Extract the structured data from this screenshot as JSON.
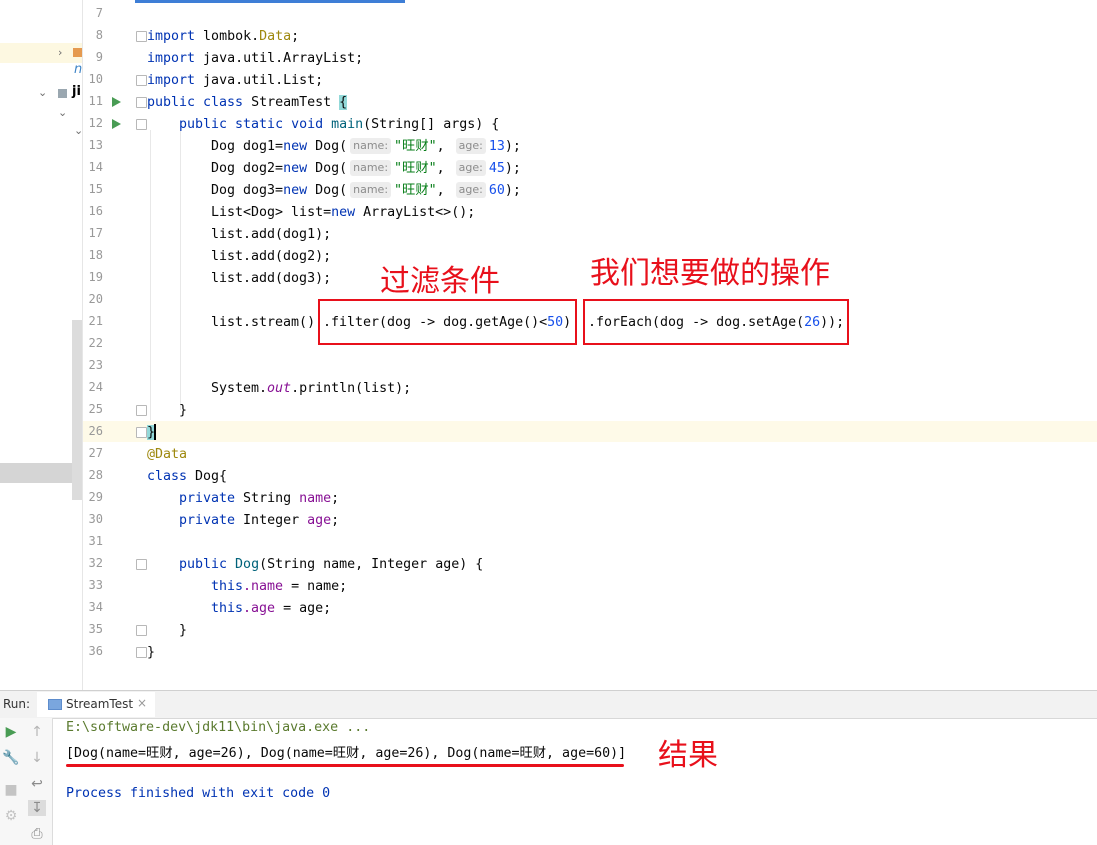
{
  "project_panel": {
    "item_text": "ji",
    "item_text2": "n"
  },
  "editor": {
    "line_numbers": [
      "7",
      "8",
      "9",
      "10",
      "11",
      "12",
      "13",
      "14",
      "15",
      "16",
      "17",
      "18",
      "19",
      "20",
      "21",
      "22",
      "23",
      "24",
      "25",
      "26",
      "27",
      "28",
      "29",
      "30",
      "31",
      "32",
      "33",
      "34",
      "35",
      "36"
    ],
    "code": {
      "l8_kw": "import",
      "l8_rest": " lombok.",
      "l8_ann": "Data",
      "l8_end": ";",
      "l9_kw": "import",
      "l9_rest": " java.util.ArrayList;",
      "l10_kw": "import",
      "l10_rest": " java.util.List;",
      "l11_kw": "public class",
      "l11_rest": " StreamTest ",
      "l11_brace": "{",
      "l12_kw": "public static void",
      "l12_fn": " main",
      "l12_rest": "(String[] args) {",
      "dog_decl_1": "Dog dog1=",
      "dog_decl_2": "Dog dog2=",
      "dog_decl_3": "Dog dog3=",
      "new_kw": "new",
      "dog_ctor": " Dog(",
      "hint_name": "name:",
      "hint_age": "age:",
      "str_name": "\"旺财\"",
      "comma": ", ",
      "age1": "13",
      "age2": "45",
      "age3": "60",
      "close": ");",
      "l16_a": "List<Dog> list=",
      "l16_new": "new",
      "l16_b": " ArrayList<>();",
      "l17": "list.add(dog1);",
      "l18": "list.add(dog2);",
      "l19": "list.add(dog3);",
      "l21_a": "list.stream()",
      "l21_b": ".filter(dog -> dog.getAge()<",
      "l21_num": "50",
      "l21_c": ")",
      "l21_d": ".forEach(dog -> dog.setAge(",
      "l21_num2": "26",
      "l21_e": "));",
      "l24_a": "System.",
      "l24_out": "out",
      "l24_b": ".println(list);",
      "l25": "}",
      "l26": "}",
      "l27": "@Data",
      "l28_kw": "class",
      "l28_rest": " Dog{",
      "l29_kw": "private",
      "l29_rest": " String ",
      "l29_fld": "name",
      "l29_end": ";",
      "l30_kw": "private",
      "l30_rest": " Integer ",
      "l30_fld": "age",
      "l30_end": ";",
      "l32_kw": "public",
      "l32_fn": " Dog",
      "l32_rest": "(String name, Integer age) {",
      "l33_kw": "this",
      "l33_fld": ".name",
      "l33_rest": " = name;",
      "l34_kw": "this",
      "l34_fld": ".age",
      "l34_rest": " = age;",
      "l35": "}",
      "l36": "}"
    }
  },
  "annotations": {
    "filter_label": "过滤条件",
    "foreach_label": "我们想要做的操作",
    "result_label": "结果"
  },
  "run_panel": {
    "label": "Run:",
    "tab_name": "StreamTest",
    "tab_close": "×",
    "java_cmd": "E:\\software-dev\\jdk11\\bin\\java.exe ...",
    "output": "[Dog(name=旺财, age=26), Dog(name=旺财, age=26), Dog(name=旺财, age=60)]",
    "exit_msg": "Process finished with exit code 0",
    "tool_icons": [
      "run-icon",
      "up-icon",
      "wrench-icon",
      "down-icon",
      "soft-wrap-icon",
      "stop-icon",
      "scroll-end-icon",
      "settings-icon",
      "print-icon"
    ]
  },
  "colors": {
    "keyword": "#0033b3",
    "annotation_red": "#e8101b",
    "string": "#067d17",
    "number": "#1750eb"
  }
}
